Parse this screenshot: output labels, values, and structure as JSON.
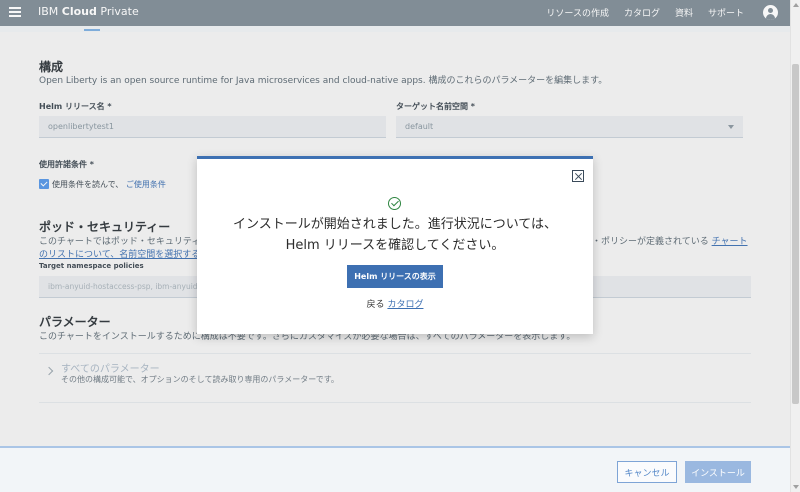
{
  "header": {
    "brand_prefix": "IBM",
    "brand_bold": "Cloud",
    "brand_suffix": "Private",
    "nav": [
      "リソースの作成",
      "カタログ",
      "資料",
      "サポート"
    ]
  },
  "config": {
    "title": "構成",
    "description": "Open Liberty is an open source runtime for Java microservices and cloud-native apps. 構成のこれらのパラメーターを編集します。",
    "release_label": "Helm リリース名 *",
    "release_value": "openlibertytest1",
    "namespace_label": "ターゲット名前空間 *",
    "namespace_value": "default",
    "license_label": "使用許諾条件 *",
    "license_text": "使用条件を読んで、",
    "license_link": "ご使用条件"
  },
  "pod_security": {
    "title": "ポッド・セキュリティー",
    "desc_left": "このチャートではポッド・セキュリティ",
    "desc_right": "・ポリシーが定義されている",
    "link_right": "チャート",
    "link_left": "のリストについて、名前空間を選択する",
    "target_label": "Target namespace policies",
    "target_value": "ibm-anyuid-hostaccess-psp, ibm-anyuid-h"
  },
  "parameters": {
    "title": "パラメーター",
    "description": "このチャートをインストールするために構成は不要です。さらにカスタマイズが必要な場合は、すべてのパラメーターを表示します。",
    "all_title": "すべてのパラメーター",
    "all_desc": "その他の構成可能で、オプションのそして読み取り専用のパラメーターです。"
  },
  "footer": {
    "cancel": "キャンセル",
    "install": "インストール"
  },
  "modal": {
    "line1": "インストールが開始されました。進行状況については、",
    "line2": "Helm リリースを確認してください。",
    "view_button": "Helm リリースの表示",
    "back_text": "戻る",
    "back_link": "カタログ"
  }
}
